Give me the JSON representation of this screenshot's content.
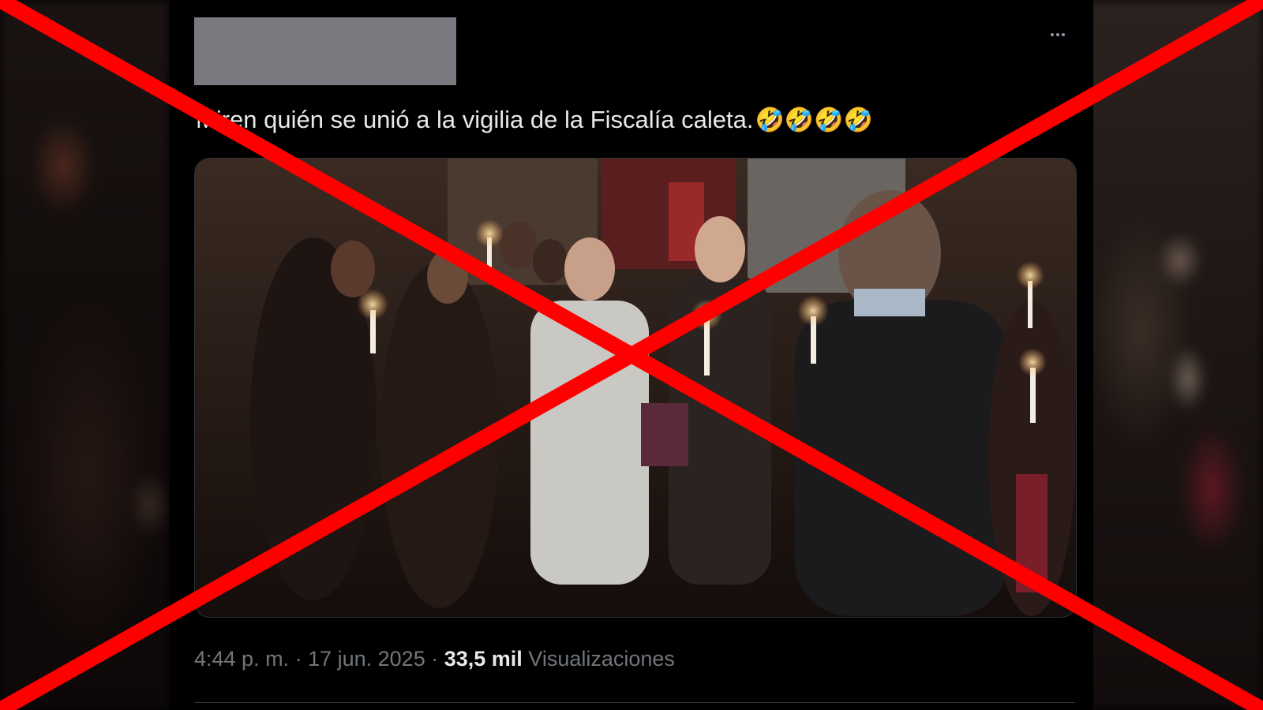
{
  "tweet": {
    "text": "Miren quién se unió a la vigilia de la Fiscalía caleta.",
    "emojis": "🤣🤣🤣🤣",
    "more_options_icon": "more-horizontal-icon",
    "time": "4:44 p. m.",
    "separator": " · ",
    "date": "17 jun. 2025",
    "views_count": "33,5 mil",
    "views_label": "Visualizaciones"
  },
  "overlay": {
    "icon": "red-x-cross-icon",
    "color": "#ff0000"
  }
}
